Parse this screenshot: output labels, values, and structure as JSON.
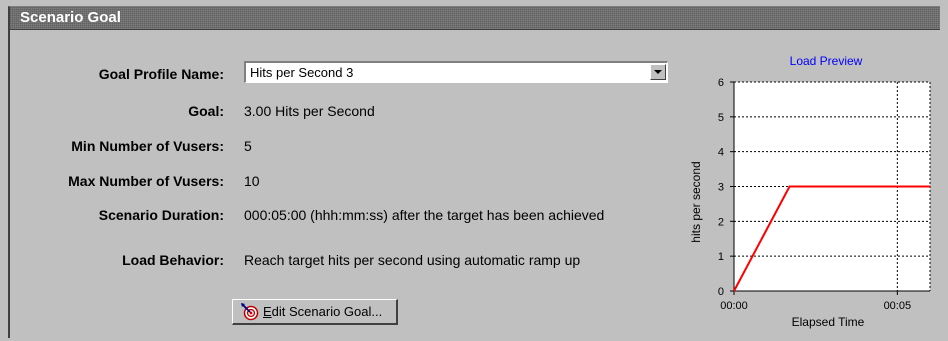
{
  "title": "Scenario Goal",
  "fields": {
    "goal_profile_name": {
      "label": "Goal Profile Name:",
      "value": "Hits per Second 3"
    },
    "goal": {
      "label": "Goal:",
      "value": "3.00 Hits per Second"
    },
    "min_vusers": {
      "label": "Min Number of Vusers:",
      "value": "5"
    },
    "max_vusers": {
      "label": "Max Number of Vusers:",
      "value": "10"
    },
    "duration": {
      "label": "Scenario Duration:",
      "value": "000:05:00 (hhh:mm:ss) after the target has been achieved"
    },
    "load_behavior": {
      "label": "Load Behavior:",
      "value": "Reach target hits per second using automatic ramp up"
    }
  },
  "edit_button": {
    "label": "Edit Scenario Goal...",
    "icon": "target-edit-icon"
  },
  "chart_data": {
    "type": "line",
    "title": "Load Preview",
    "xlabel": "Elapsed Time",
    "ylabel": "hits per second",
    "ylim": [
      0,
      6
    ],
    "y_ticks": [
      "0",
      "1",
      "2",
      "3",
      "4",
      "5",
      "6"
    ],
    "x_ticks": [
      "00:00",
      "00:05"
    ],
    "grid": true,
    "series": [
      {
        "color": "#ff0000",
        "x_minutes": [
          0,
          1.7,
          6.0
        ],
        "values": [
          0,
          3,
          3
        ]
      }
    ]
  },
  "colors": {
    "line": "#ff0000",
    "title": "#0000ff",
    "window": "#c0c0c0"
  }
}
